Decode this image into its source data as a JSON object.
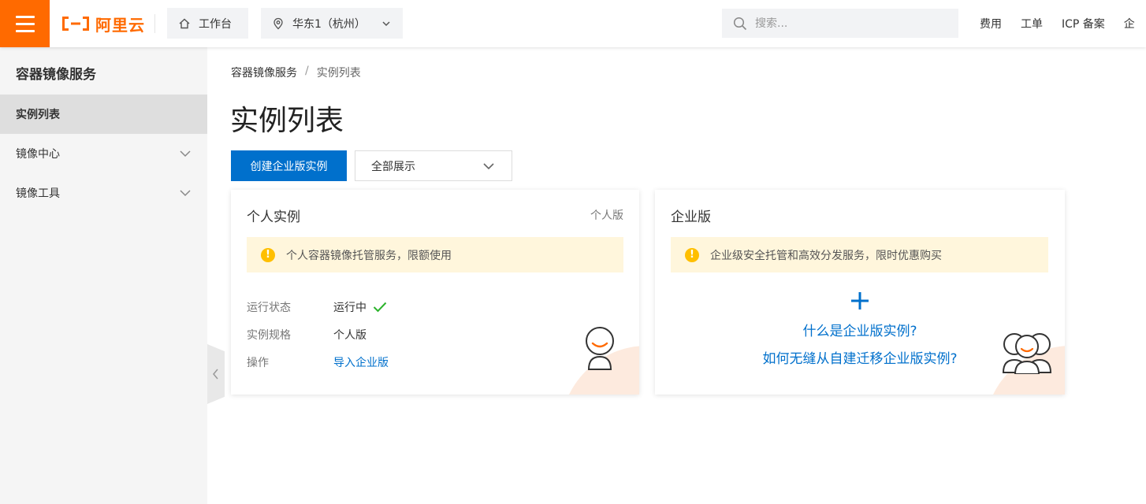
{
  "topbar": {
    "brand": "阿里云",
    "workbench_label": "工作台",
    "region_label": "华东1（杭州）",
    "search_placeholder": "搜索...",
    "links": [
      "费用",
      "工单",
      "ICP 备案",
      "企"
    ]
  },
  "sidebar": {
    "title": "容器镜像服务",
    "items": [
      {
        "label": "实例列表",
        "active": true
      },
      {
        "label": "镜像中心",
        "expandable": true
      },
      {
        "label": "镜像工具",
        "expandable": true
      }
    ]
  },
  "breadcrumb": {
    "root": "容器镜像服务",
    "separator": "/",
    "current": "实例列表"
  },
  "page": {
    "title": "实例列表",
    "create_button": "创建企业版实例",
    "filter_value": "全部展示"
  },
  "personal_card": {
    "title": "个人实例",
    "tag": "个人版",
    "notice": "个人容器镜像托管服务，限额使用",
    "status_label": "运行状态",
    "status_value": "运行中",
    "spec_label": "实例规格",
    "spec_value": "个人版",
    "action_label": "操作",
    "action_link": "导入企业版"
  },
  "enterprise_card": {
    "title": "企业版",
    "notice": "企业级安全托管和高效分发服务，限时优惠购买",
    "link_what": "什么是企业版实例?",
    "link_migrate": "如何无缝从自建迁移企业版实例?"
  },
  "colors": {
    "brand_orange": "#ff6a00",
    "primary_blue": "#0070cc",
    "success_green": "#2bb32b",
    "warning_yellow": "#ffbf00"
  }
}
